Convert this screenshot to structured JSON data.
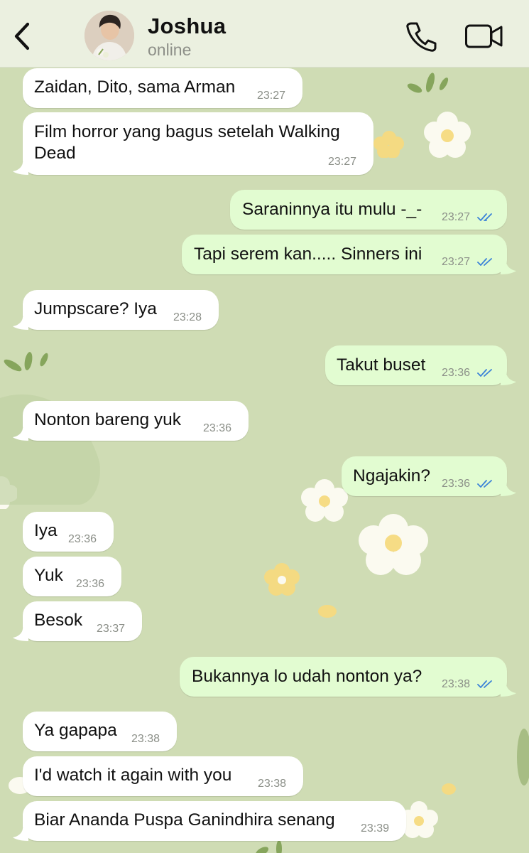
{
  "header": {
    "contact_name": "Joshua",
    "status": "online",
    "back_icon": "chevron-left-icon",
    "call_icon": "phone-icon",
    "video_icon": "video-camera-icon"
  },
  "colors": {
    "wallpaper": "#cfdcb4",
    "incoming_bubble": "#ffffff",
    "outgoing_bubble": "#e2fcd1",
    "read_ticks": "#3b82d8"
  },
  "messages": [
    {
      "direction": "in",
      "text": "Zaidan, Dito, sama Arman",
      "time": "23:27"
    },
    {
      "direction": "in",
      "text_line1": "Film horror yang bagus setelah Walking",
      "text_line2": "Dead",
      "time": "23:27"
    },
    {
      "direction": "out",
      "text": "Saraninnya itu mulu -_-",
      "time": "23:27",
      "status": "read"
    },
    {
      "direction": "out",
      "text": "Tapi serem kan..... Sinners ini",
      "time": "23:27",
      "status": "read"
    },
    {
      "direction": "in",
      "text": "Jumpscare? Iya",
      "time": "23:28"
    },
    {
      "direction": "out",
      "text": "Takut buset",
      "time": "23:36",
      "status": "read"
    },
    {
      "direction": "in",
      "text": "Nonton bareng yuk",
      "time": "23:36"
    },
    {
      "direction": "out",
      "text": "Ngajakin?",
      "time": "23:36",
      "status": "read"
    },
    {
      "direction": "in",
      "text": "Iya",
      "time": "23:36"
    },
    {
      "direction": "in",
      "text": "Yuk",
      "time": "23:36"
    },
    {
      "direction": "in",
      "text": "Besok",
      "time": "23:37"
    },
    {
      "direction": "out",
      "text": "Bukannya lo udah nonton ya?",
      "time": "23:38",
      "status": "read"
    },
    {
      "direction": "in",
      "text": "Ya gapapa",
      "time": "23:38"
    },
    {
      "direction": "in",
      "text": "I'd watch it again with you",
      "time": "23:38"
    },
    {
      "direction": "in",
      "text": "Biar Ananda Puspa Ganindhira senang",
      "time": "23:39"
    }
  ]
}
